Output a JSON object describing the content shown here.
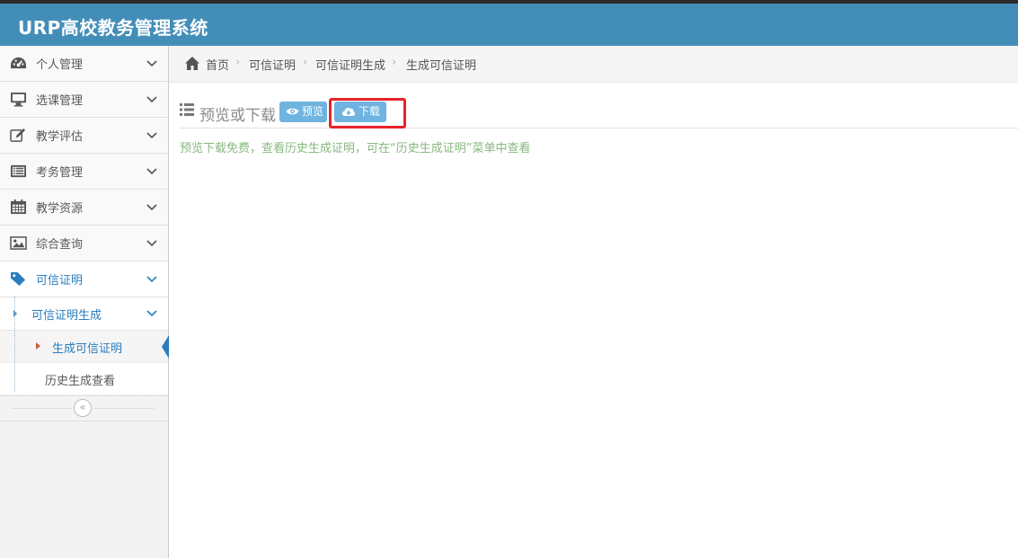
{
  "app": {
    "title": "URP高校教务管理系统",
    "header_color": "#438eb9",
    "accent_color": "#2b7dbc"
  },
  "sidebar": {
    "items": [
      {
        "label": "个人管理",
        "icon": "tachometer-icon"
      },
      {
        "label": "选课管理",
        "icon": "desktop-icon"
      },
      {
        "label": "教学评估",
        "icon": "pencil-square-icon"
      },
      {
        "label": "考务管理",
        "icon": "list-alt-icon"
      },
      {
        "label": "教学资源",
        "icon": "calendar-icon"
      },
      {
        "label": "综合查询",
        "icon": "picture-icon"
      },
      {
        "label": "可信证明",
        "icon": "tag-icon",
        "open": true
      }
    ],
    "submenu": {
      "label": "可信证明生成",
      "children": [
        {
          "label": "生成可信证明",
          "active": true
        },
        {
          "label": "历史生成查看"
        }
      ]
    },
    "collapse_icon": "double-chevron-left-icon"
  },
  "breadcrumbs": {
    "home": "首页",
    "items": [
      "可信证明",
      "可信证明生成",
      "生成可信证明"
    ]
  },
  "page": {
    "title": "预览或下载",
    "preview_button": "预览",
    "download_button": "下载",
    "notice": "预览下载免费，查看历史生成证明，可在“历史生成证明”菜单中查看",
    "highlight_color": "#e8232a"
  }
}
